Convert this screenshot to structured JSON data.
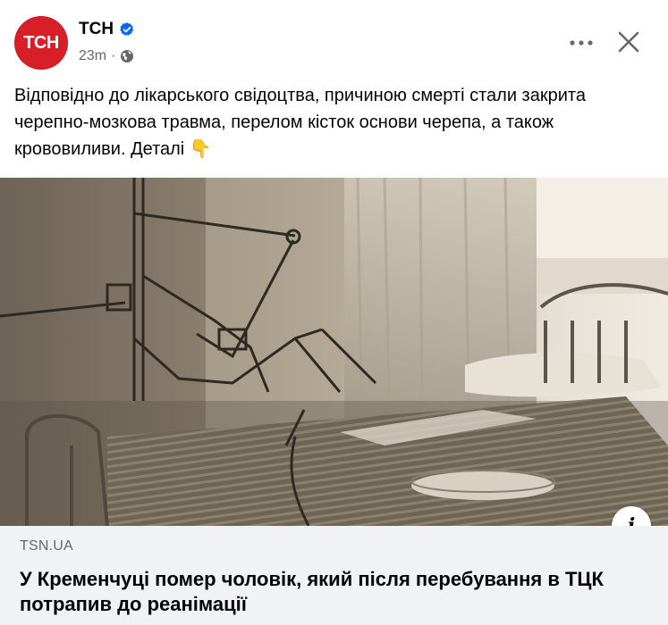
{
  "post": {
    "page_name": "ТСН",
    "avatar_text": "ТСН",
    "time": "23m",
    "separator": "·",
    "text": "Відповідно до лікарського свідоцтва, причиною смерті стали закрита черепно-мозкова травма, перелом кісток основи черепа, а також крововиливи. Деталі 👇",
    "icons": {
      "verified": "verified-badge-icon",
      "audience": "globe-icon",
      "more": "more-options-icon",
      "close": "close-icon",
      "info": "info-icon"
    },
    "colors": {
      "avatar_bg": "#d81e26",
      "verified": "#0866ff",
      "secondary_text": "#65676b",
      "card_bg": "#f0f2f5"
    }
  },
  "link_preview": {
    "domain": "TSN.UA",
    "title": "У Кременчуці помер чоловік, який після перебування в ТЦК потрапив до реанімації",
    "info_label": "i"
  }
}
